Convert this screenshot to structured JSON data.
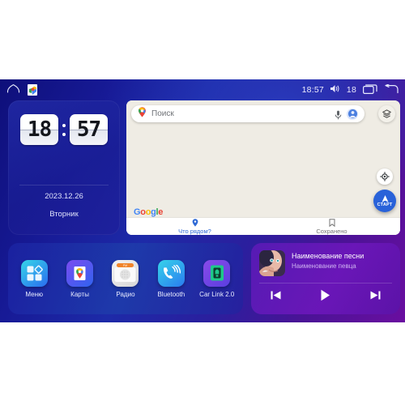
{
  "statusbar": {
    "home_icon": "home-icon",
    "notification_icon": "google-maps-notification-icon",
    "time": "18:57",
    "volume_icon": "volume-icon",
    "volume_level": "18",
    "recents_icon": "recents-icon",
    "back_icon": "back-icon"
  },
  "clock_widget": {
    "hours": "18",
    "minutes": "57",
    "date": "2023.12.26",
    "weekday": "Вторник"
  },
  "map_widget": {
    "search": {
      "placeholder": "Поиск",
      "value": "",
      "pin_icon": "map-pin-icon",
      "mic_icon": "microphone-icon",
      "avatar_icon": "account-avatar-icon"
    },
    "layers_icon": "map-layers-icon",
    "locate_icon": "my-location-icon",
    "start_button": {
      "label": "СТАРТ",
      "icon": "navigation-arrow-icon"
    },
    "attribution": "Google",
    "tabs": [
      {
        "label": "Что рядом?",
        "icon": "map-pin-icon",
        "active": true
      },
      {
        "label": "Сохранено",
        "icon": "bookmark-icon",
        "active": false
      }
    ]
  },
  "apps": [
    {
      "label": "Меню",
      "icon": "apps-grid-icon"
    },
    {
      "label": "Карты",
      "icon": "google-maps-icon"
    },
    {
      "label": "Радио",
      "icon": "radio-icon",
      "band": "FM"
    },
    {
      "label": "Bluetooth",
      "icon": "bluetooth-phone-icon"
    },
    {
      "label": "Car Link 2.0",
      "icon": "car-link-icon"
    }
  ],
  "music_widget": {
    "album_art": "album-art-portrait",
    "title": "Наименование песни",
    "artist": "Наименование певца",
    "controls": [
      {
        "name": "previous",
        "icon": "skip-previous-icon"
      },
      {
        "name": "play",
        "icon": "play-icon"
      },
      {
        "name": "next",
        "icon": "skip-next-icon"
      }
    ]
  },
  "colors": {
    "bg_blue": "#171a96",
    "bg_purple": "#6a0ea0",
    "accent_blue": "#2962d9",
    "map_bg": "#efece4",
    "tab_active": "#2f6ad6"
  }
}
